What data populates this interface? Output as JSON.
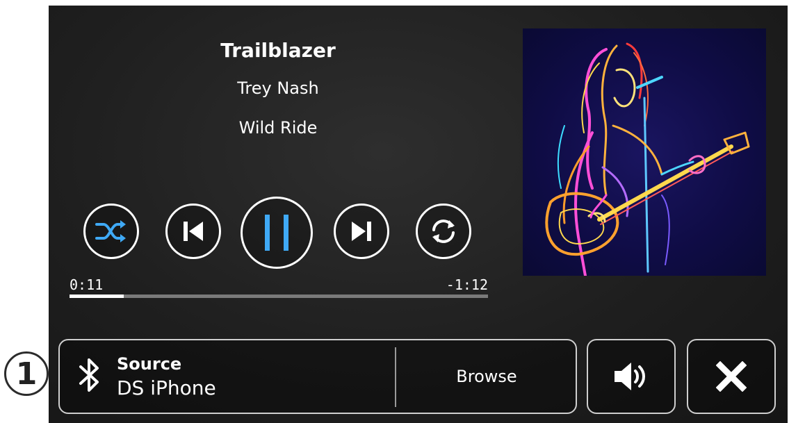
{
  "track": {
    "title": "Trailblazer",
    "artist": "Trey Nash",
    "album": "Wild Ride"
  },
  "controls": {
    "shuffle": {
      "icon": "shuffle-icon"
    },
    "previous": {
      "icon": "skip-previous-icon"
    },
    "play_pause": {
      "icon": "pause-icon",
      "state": "playing"
    },
    "next": {
      "icon": "skip-next-icon"
    },
    "repeat": {
      "icon": "repeat-icon"
    },
    "accent_color": "#3fa9f5"
  },
  "progress": {
    "elapsed": "0:11",
    "remaining": "-1:12",
    "fraction": 0.13
  },
  "source_bar": {
    "icon": "bluetooth-icon",
    "label": "Source",
    "value": "DS iPhone",
    "browse_label": "Browse"
  },
  "buttons": {
    "volume_icon": "speaker-volume-icon",
    "close_icon": "close-icon"
  },
  "callout": {
    "number": "1"
  },
  "album_art": {
    "icon": "album-art-guitarist-illustration"
  }
}
